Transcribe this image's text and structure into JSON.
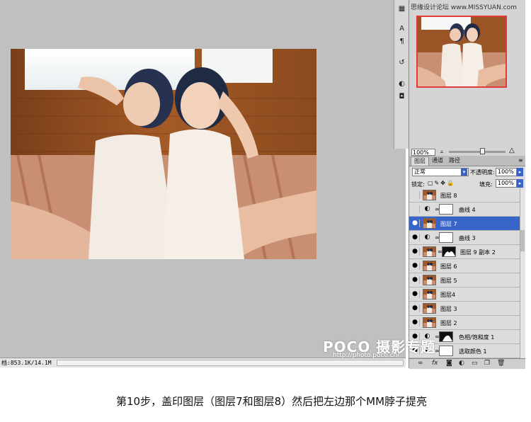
{
  "watermark_top": "思缘设计论坛 www.MISSYUAN.com",
  "status_text": "档:853.1K/14.1M",
  "navigator": {
    "zoom": "100%"
  },
  "layers_panel": {
    "tabs": [
      "图层",
      "通道",
      "路径"
    ],
    "blend_mode": "正常",
    "opacity_label": "不透明度:",
    "opacity_value": "100%",
    "lock_label": "锁定:",
    "fill_label": "填充:",
    "fill_value": "100%",
    "layers": [
      {
        "name": "图层 8",
        "kind": "pixel",
        "visible": false,
        "selected": false
      },
      {
        "name": "曲线 4",
        "kind": "adjustment",
        "visible": false,
        "selected": false
      },
      {
        "name": "图层 7",
        "kind": "pixel",
        "visible": true,
        "selected": true
      },
      {
        "name": "曲线 3",
        "kind": "adjustment",
        "visible": true,
        "selected": false
      },
      {
        "name": "图层 9 副本 2",
        "kind": "pixel-mask",
        "visible": true,
        "selected": false
      },
      {
        "name": "图层 6",
        "kind": "pixel",
        "visible": true,
        "selected": false
      },
      {
        "name": "图层 5",
        "kind": "pixel",
        "visible": true,
        "selected": false
      },
      {
        "name": "图层4",
        "kind": "pixel",
        "visible": true,
        "selected": false
      },
      {
        "name": "图层 3",
        "kind": "pixel",
        "visible": true,
        "selected": false
      },
      {
        "name": "图层 2",
        "kind": "pixel",
        "visible": true,
        "selected": false
      },
      {
        "name": "色相/饱和度 1",
        "kind": "adjustment",
        "visible": true,
        "selected": false
      },
      {
        "name": "选取颜色 1",
        "kind": "adjustment",
        "visible": true,
        "selected": false
      }
    ]
  },
  "poco": {
    "brand": "POCO 摄影专题",
    "url": "http://photo.poco.cn/"
  },
  "caption": "第10步，盖印图层（图层7和图层8）然后把左边那个MM脖子提亮",
  "colors": {
    "selection": "#3765c9",
    "canvas_bg": "#c0c0c0",
    "navigator_frame": "#e03a3a"
  }
}
